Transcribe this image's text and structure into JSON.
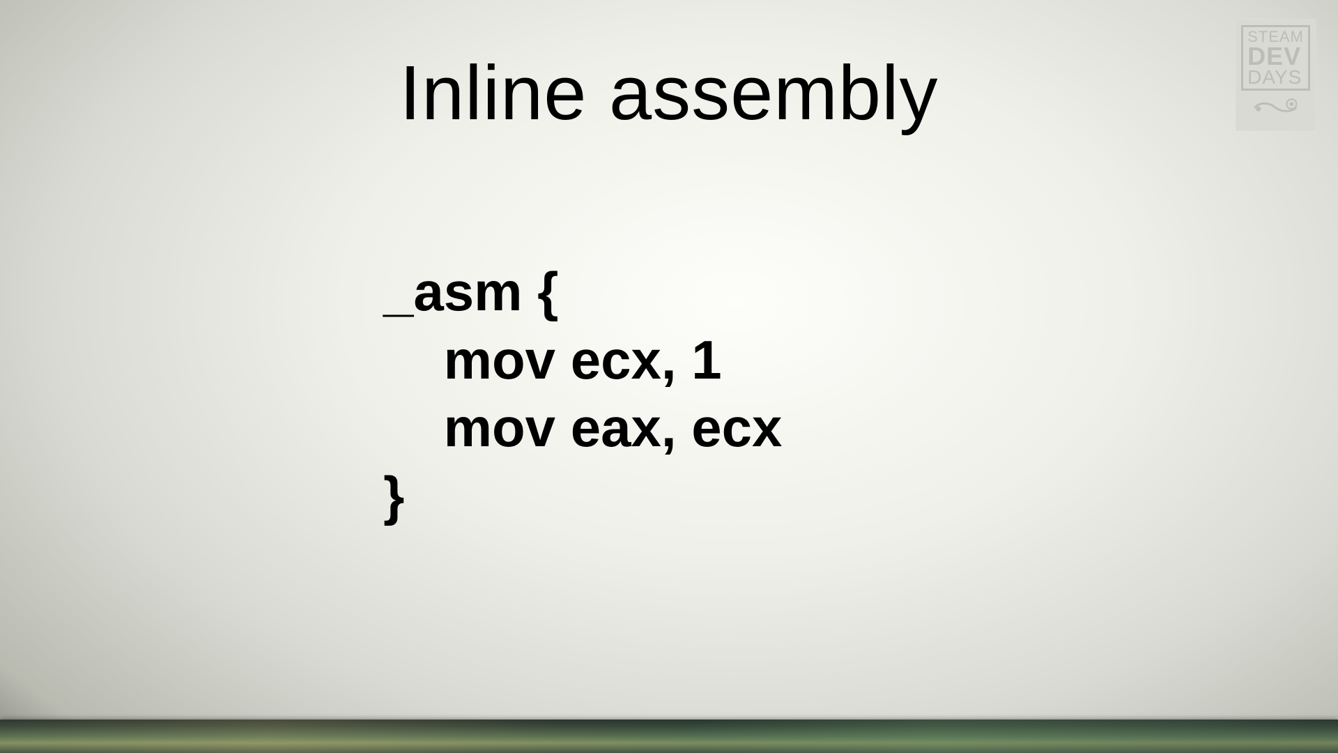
{
  "title": "Inline assembly",
  "code": {
    "line1": "_asm {",
    "line2": "    mov ecx, 1",
    "line3": "    mov eax, ecx",
    "line4": "}"
  },
  "logo": {
    "line1": "STEAM",
    "line2": "DEV",
    "line3": "DAYS"
  }
}
